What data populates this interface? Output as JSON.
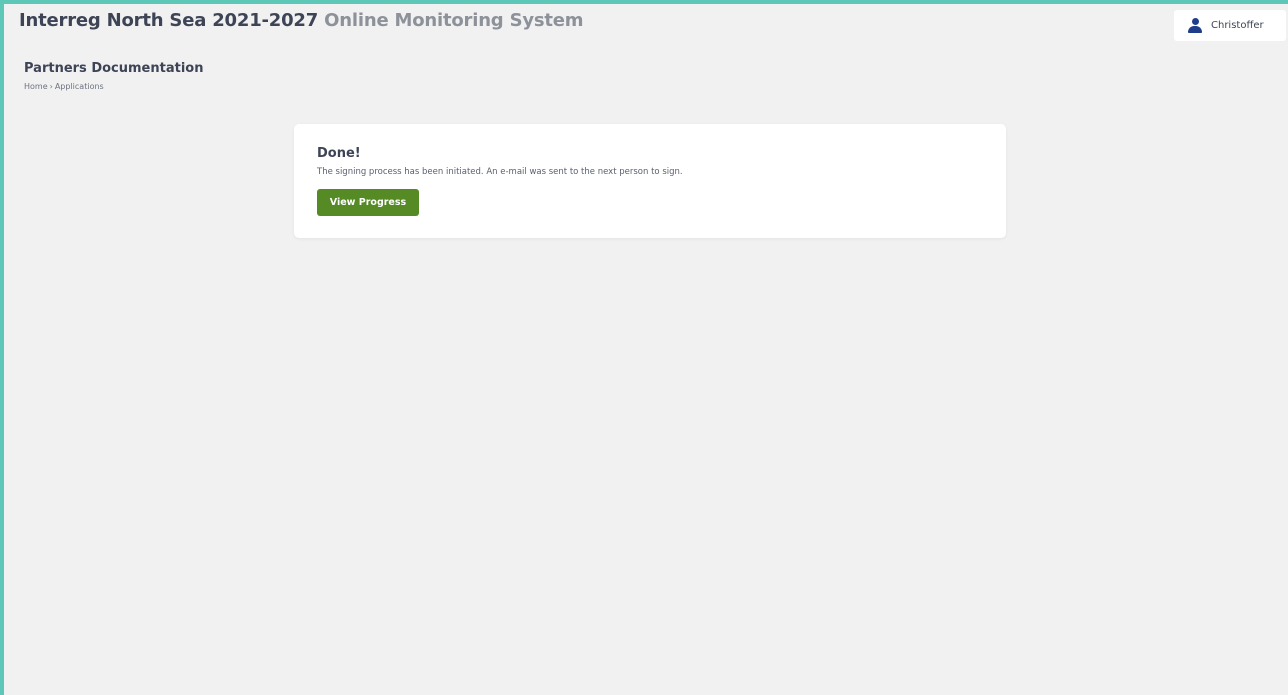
{
  "header": {
    "title_strong": "Interreg North Sea 2021-2027",
    "title_muted": "Online Monitoring System",
    "user_name": "Christoffer",
    "user_icon": "user-icon"
  },
  "page": {
    "title": "Partners Documentation",
    "breadcrumb": {
      "home": "Home",
      "separator": "›",
      "current": "Applications"
    }
  },
  "card": {
    "title": "Done!",
    "message": "The signing process has been initiated. An e-mail was sent to the next person to sign.",
    "button_label": "View Progress"
  },
  "colors": {
    "accent_border": "#5ec8b8",
    "button_green": "#558a25",
    "user_icon": "#1f3e8a",
    "background": "#f1f1f1"
  }
}
